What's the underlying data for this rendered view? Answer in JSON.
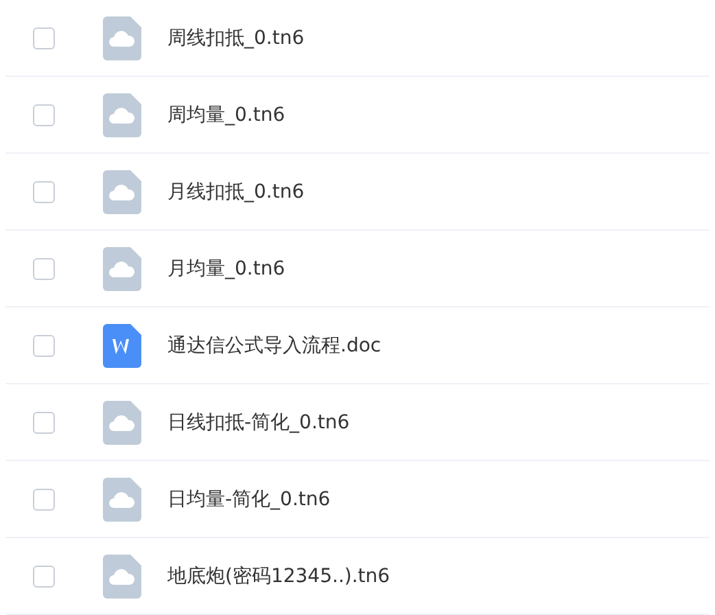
{
  "files": [
    {
      "name": "周线扣抵_0.tn6",
      "kind": "cloud",
      "checked": false
    },
    {
      "name": "周均量_0.tn6",
      "kind": "cloud",
      "checked": false
    },
    {
      "name": "月线扣抵_0.tn6",
      "kind": "cloud",
      "checked": false
    },
    {
      "name": "月均量_0.tn6",
      "kind": "cloud",
      "checked": false
    },
    {
      "name": "通达信公式导入流程.doc",
      "kind": "word",
      "checked": false
    },
    {
      "name": "日线扣抵-简化_0.tn6",
      "kind": "cloud",
      "checked": false
    },
    {
      "name": "日均量-简化_0.tn6",
      "kind": "cloud",
      "checked": false
    },
    {
      "name": "地底炮(密码12345..).tn6",
      "kind": "cloud",
      "checked": false
    }
  ]
}
